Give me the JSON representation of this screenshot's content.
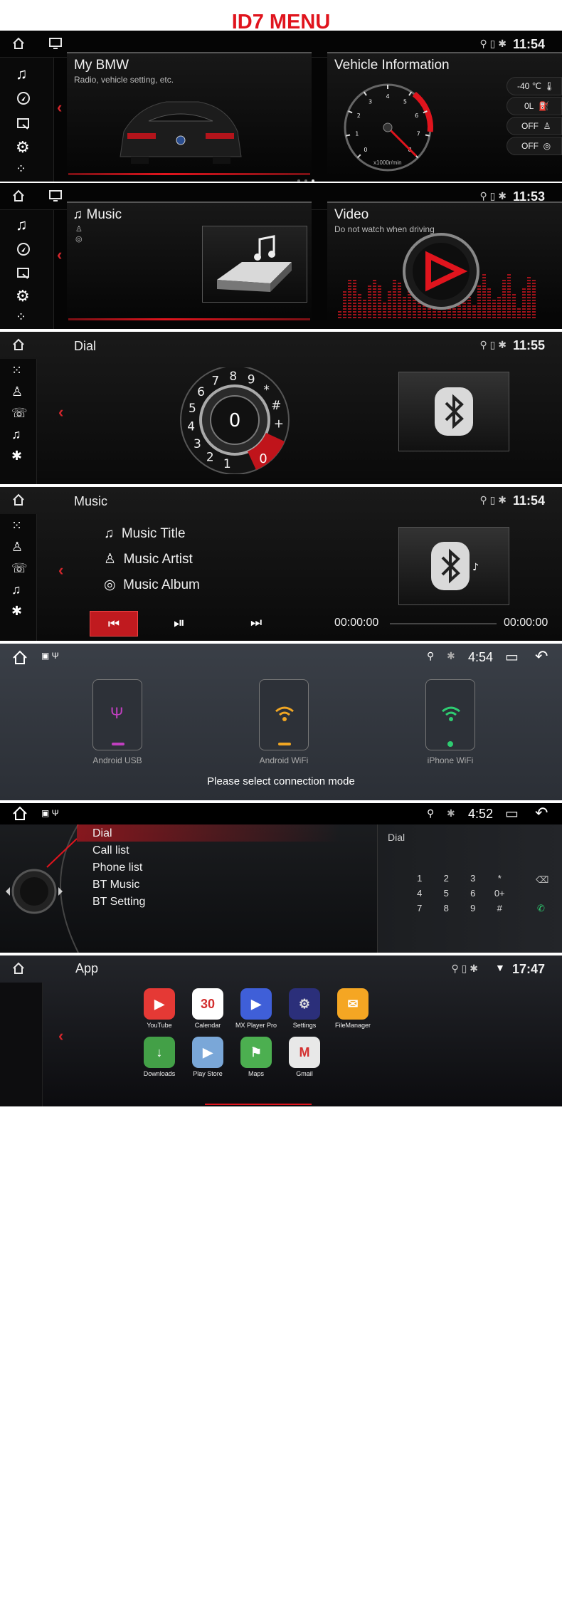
{
  "header": {
    "title": "ID7 MENU"
  },
  "s1": {
    "time": "11:54",
    "my_bmw_title": "My BMW",
    "my_bmw_sub": "Radio, vehicle setting, etc.",
    "vehicle_title": "Vehicle Information",
    "gauge_unit": "x1000r/min",
    "gauge_ticks": [
      "0",
      "1",
      "2",
      "3",
      "4",
      "5",
      "6",
      "7",
      "8"
    ],
    "temp": "-40 ℃",
    "fuel": "0L",
    "seatbelt": "OFF",
    "tire": "OFF"
  },
  "s2": {
    "time": "11:53",
    "music_title": "Music",
    "video_title": "Video",
    "video_sub": "Do not watch when driving"
  },
  "s3": {
    "time": "11:55",
    "title": "Dial",
    "dial_zero": "0",
    "keys": [
      "1",
      "2",
      "3",
      "4",
      "5",
      "6",
      "7",
      "8",
      "9",
      "*",
      "#",
      "+"
    ],
    "red_key": "0"
  },
  "s4": {
    "time": "11:54",
    "title": "Music",
    "music_title": "Music Title",
    "music_artist": "Music Artist",
    "music_album": "Music Album",
    "elapsed": "00:00:00",
    "total": "00:00:00"
  },
  "s5": {
    "time": "4:54",
    "opt1": "Android USB",
    "opt2": "Android WiFi",
    "opt3": "iPhone WiFi",
    "prompt": "Please select connection mode"
  },
  "s6": {
    "time": "4:52",
    "menu": [
      "Dial",
      "Call list",
      "Phone list",
      "BT Music",
      "BT Setting"
    ],
    "dial_label": "Dial",
    "keys": [
      "1",
      "2",
      "3",
      "*",
      "4",
      "5",
      "6",
      "0+",
      "7",
      "8",
      "9",
      "#"
    ]
  },
  "s7": {
    "time": "17:47",
    "title": "App",
    "apps": [
      "YouTube",
      "Calendar",
      "MX Player Pro",
      "Settings",
      "FileManager",
      "Downloads",
      "Play Store",
      "Maps",
      "Gmail"
    ],
    "calendar_day": "30"
  },
  "colors": {
    "accent": "#e0141d",
    "bg": "#050505"
  }
}
